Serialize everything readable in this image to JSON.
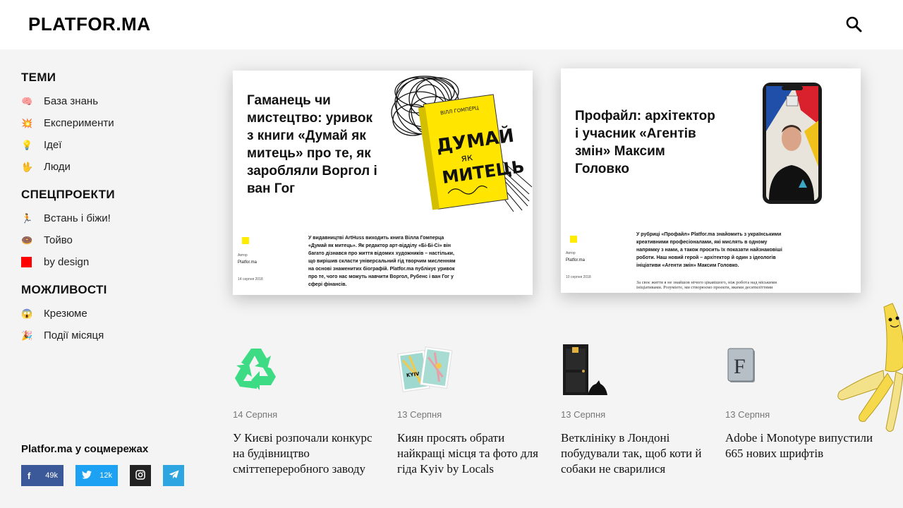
{
  "header": {
    "logo": "PLATFOR.MA",
    "search_icon": "search-icon"
  },
  "sidebar": {
    "sections": [
      {
        "title": "ТЕМИ",
        "items": [
          {
            "label": "База знань",
            "icon": "brain-icon",
            "glyph": "🧠"
          },
          {
            "label": "Експерименти",
            "icon": "explosion-icon",
            "glyph": "💥"
          },
          {
            "label": "Ідеї",
            "icon": "lightbulb-icon",
            "glyph": "💡"
          },
          {
            "label": "Люди",
            "icon": "hand-icon",
            "glyph": "🖖"
          }
        ]
      },
      {
        "title": "СПЕЦПРОЕКТИ",
        "items": [
          {
            "label": "Встань і біжи!",
            "icon": "runner-icon",
            "glyph": "🏃"
          },
          {
            "label": "Тойво",
            "icon": "donut-icon",
            "glyph": "🍩"
          },
          {
            "label": "by design",
            "icon": "red-square-icon",
            "glyph": ""
          }
        ]
      },
      {
        "title": "МОЖЛИВОСТІ",
        "items": [
          {
            "label": "Крезюме",
            "icon": "scream-face-icon",
            "glyph": "😱"
          },
          {
            "label": "Події місяця",
            "icon": "party-popper-icon",
            "glyph": "🎉"
          }
        ]
      }
    ]
  },
  "social": {
    "title": "Platfor.ma у соцмережах",
    "facebook": {
      "icon_text": "f",
      "count": "49k"
    },
    "twitter": {
      "count": "12k"
    }
  },
  "featured": [
    {
      "title": "Гаманець чи мистецтво: уривок з книги «Думай як митець» про те, як заробляли Воргол і ван Гог",
      "author_label": "Автор",
      "author": "Platfor.ma",
      "date": "14 серпня 2018",
      "lead": "У видавництві ArtHuss виходить книга Вілла Гомперца «Думай як митець». Як редактор арт-відділу «Бі-Бі-Сі» він багато дізнався про життя відомих художників – настільки, що вирішив скласти універсальний гід творчим мисленням на основі знаменитих біографій. Platfor.ma публікує уривок про те, чого нас можуть навчити Воргол, Рубенс і ван Гог у сфері фінансів.",
      "book_author": "ВІЛЛ ГОМПЕРЦ",
      "book_title_line1": "ДУМАЙ",
      "book_title_line2": "як",
      "book_title_line3": "МИТЕЦЬ"
    },
    {
      "title": "Профайл: архітектор і учасник «Агентів змін» Максим Головко",
      "author_label": "Автор",
      "author": "Platfor.ma",
      "date": "10 серпня 2018",
      "lead": "У рубриці «Профайл» Platfor.ma знайомить з українськими креативними професіоналами, які мислять в одному напрямку з нами, а також просить їх показати найзнаковіші роботи. Наш новий герой – архітектор й один з ідеологів ініціативи «Агенти змін» Максим Головко.",
      "lead2": "За своє життя я не знайшов нічого цікавішого, ніж робота над міськими ініціативами. Розуміете, ми створюємо проекти, якими десятиліттями"
    }
  ],
  "news": [
    {
      "date": "14 Серпня",
      "title": "У Києві розпочали конкурс на будівництво сміттепереробного заводу",
      "icon": "recycle-icon"
    },
    {
      "date": "13 Серпня",
      "title": "Киян просять обрати найкращі місця та фото для гіда Kyiv by Locals",
      "icon": "map-cards-icon",
      "img_text": "KYIV"
    },
    {
      "date": "13 Серпня",
      "title": "Ветклініку в Лондоні побудували так, щоб коти й собаки не сварилися",
      "icon": "door-cat-icon"
    },
    {
      "date": "13 Серпня",
      "title": "Adobe і Monotype випустили 665 нових шрифтів",
      "icon": "font-book-icon",
      "img_text": "F"
    }
  ],
  "colors": {
    "accent_yellow": "#ffec00",
    "red": "#ff0000",
    "facebook": "#3b5998",
    "twitter": "#1da1f2",
    "telegram": "#2ca5e0",
    "recycle_green": "#3ddc84"
  }
}
